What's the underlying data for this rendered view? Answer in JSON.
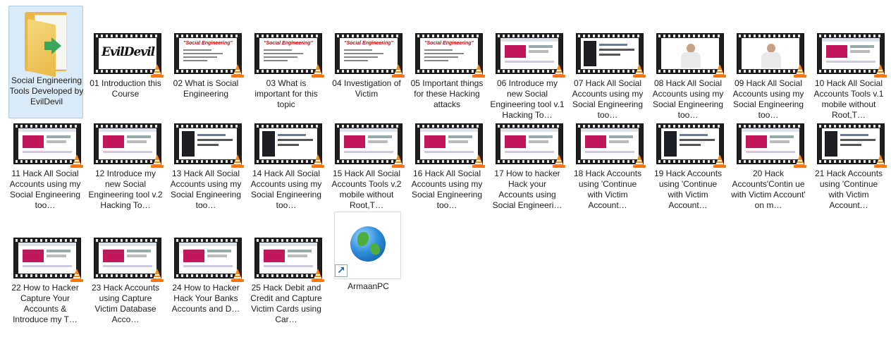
{
  "folder": {
    "label": "Social Engineering Tools Developed by EvilDevil",
    "icon": "folder-icon"
  },
  "videos": [
    "01 Introduction this Course",
    "02 What is Social Engineering",
    "03 What is important for this topic",
    "04 Investigation of Victim",
    "05 Important things for these Hacking attacks",
    "06 Introduce my new  Social Engineering tool v.1 Hacking To…",
    "07 Hack  All Social Accounts using my Social Engineering too…",
    "08 Hack  All Social Accounts using my Social Engineering too…",
    "09 Hack All Social Accounts using my Social Engineering too…",
    "10 Hack All Social Accounts Tools v.1 mobile without Root,T…",
    "11 Hack All Social Accounts using my Social Engineering too…",
    "12 Introduce my new  Social Engineering tool v.2 Hacking To…",
    "13 Hack  All Social Accounts using my Social Engineering too…",
    "14 Hack All Social Accounts using my Social Engineering too…",
    "15 Hack All Social Accounts Tools v.2 mobile without Root,T…",
    "16  Hack  All Social Accounts using my Social Engineering too…",
    "17 How to hacker Hack your Accounts using Social Engineeri…",
    "18 Hack Accounts using 'Continue with Victim Account…",
    "19 Hack Accounts using 'Continue with Victim Account…",
    "20 Hack Accounts'Contin ue with Victim Account' on m…",
    "21 Hack Accounts using 'Continue with Victim Account…",
    "22 How to Hacker Capture Your Accounts & Introduce my T…",
    "23 Hack Accounts using Capture Victim Database Acco…",
    "24 How to Hacker Hack Your Banks Accounts and D…",
    "25 Hack Debit and Credit and Capture Victim Cards using Car…"
  ],
  "thumb_text": {
    "evil_logo": "EvilDevil",
    "slide_title": "\"Social Engineering\""
  },
  "shortcut": {
    "label": "ArmaanPC",
    "icon": "globe-icon"
  },
  "colors": {
    "selection": "#dbeaf9",
    "vlc": "#ff8800"
  }
}
